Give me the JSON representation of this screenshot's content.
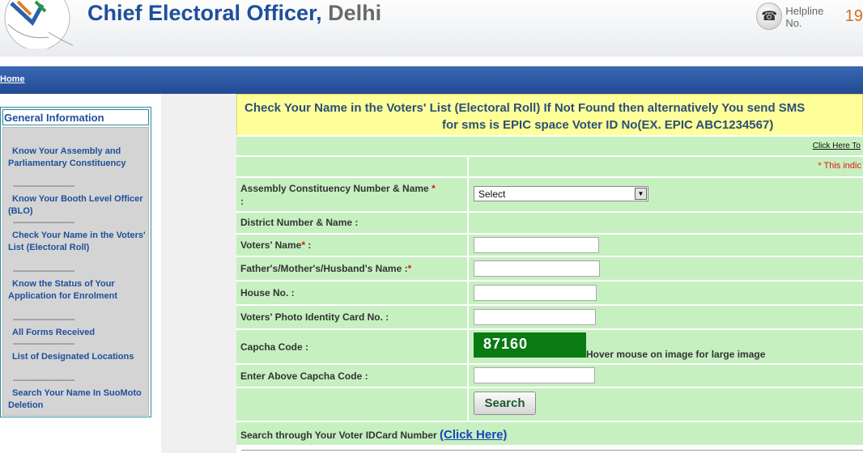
{
  "header": {
    "title_main": "Chief Electoral Officer, ",
    "title_city": "Delhi",
    "helpline_label": "Helpline No.",
    "helpline_number": "19"
  },
  "nav": {
    "home": "Home"
  },
  "sidebar": {
    "title": "General Information",
    "items": [
      {
        "label": "Know Your Assembly and Parliamentary Constituency"
      },
      {
        "label": "Know Your Booth Level Officer (BLO)"
      },
      {
        "label": "Check Your Name in the Voters' List (Electoral Roll)"
      },
      {
        "label": "Know the Status of Your Application for Enrolment"
      },
      {
        "label": "All Forms Received"
      },
      {
        "label": "List of Designated Locations"
      },
      {
        "label": "Search Your Name In SuoMoto Deletion"
      }
    ],
    "divider": "------------------------"
  },
  "banner": {
    "line1": "Check Your Name in the Voters' List (Electoral Roll) If Not Found then alternatively You send SMS",
    "line2": "for sms is EPIC space Voter ID No(EX. EPIC ABC1234567)"
  },
  "form": {
    "click_here_to": "Click Here To",
    "required_note": "* This indic",
    "assembly_label": "Assembly Constituency Number & Name",
    "assembly_colon": ":",
    "assembly_select": "Select",
    "district_label": "District Number & Name :",
    "voter_name_label": "Voters' Name",
    "colon_after_req": " :",
    "relative_name_label": "Father's/Mother's/Husband's Name :",
    "house_label": "House No. :",
    "epic_label": "Voters' Photo Identity Card No.  :",
    "captcha_label": "Capcha Code :",
    "captcha_value": "87160",
    "captcha_hint": "Hover mouse on image for large image",
    "captcha_input_label": "Enter Above Capcha Code :",
    "search_button": "Search",
    "voterid_search_text": "Search through Your Voter IDCard Number ",
    "voterid_search_link": "(Click Here)",
    "asterisk": "*"
  },
  "colors": {
    "title_blue": "#1f4f9c",
    "nav_blue": "#2b57a3",
    "banner_yellow": "#ffff99",
    "form_green": "#c6f0c0",
    "captcha_green": "#0a7a13",
    "required_red": "#ee1111"
  }
}
